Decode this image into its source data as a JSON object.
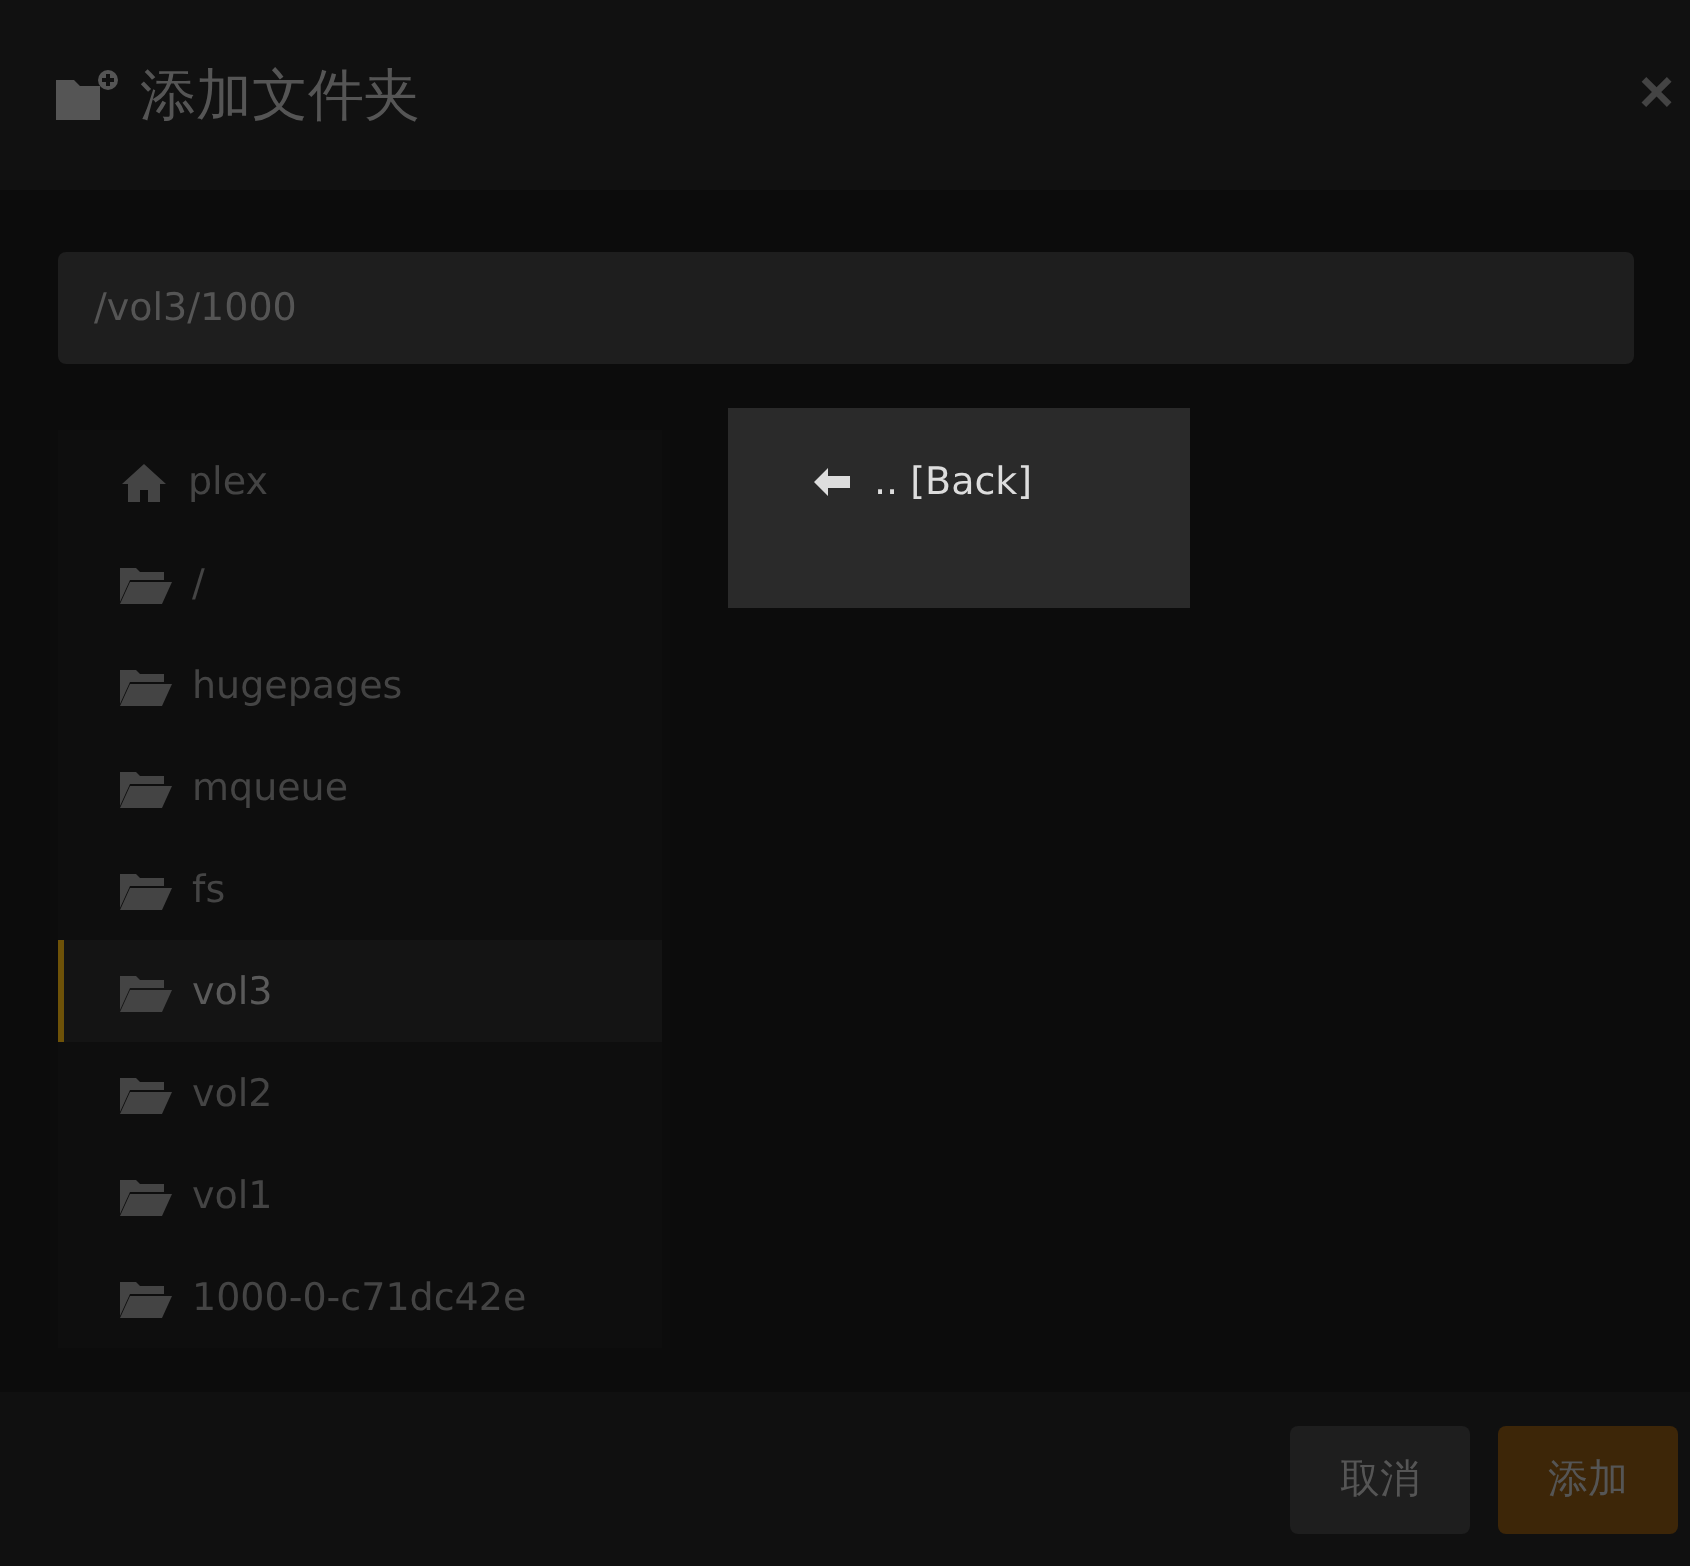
{
  "dialog": {
    "title": "添加文件夹",
    "close": "×"
  },
  "path_field": {
    "value": "/vol3/1000"
  },
  "folders": [
    {
      "name": "plex",
      "kind": "home",
      "selected": false
    },
    {
      "name": "/",
      "kind": "folder",
      "selected": false
    },
    {
      "name": "hugepages",
      "kind": "folder",
      "selected": false
    },
    {
      "name": "mqueue",
      "kind": "folder",
      "selected": false
    },
    {
      "name": "fs",
      "kind": "folder",
      "selected": false
    },
    {
      "name": "vol3",
      "kind": "folder",
      "selected": true
    },
    {
      "name": "vol2",
      "kind": "folder",
      "selected": false
    },
    {
      "name": "vol1",
      "kind": "folder",
      "selected": false
    },
    {
      "name": "1000-0-c71dc42e",
      "kind": "folder",
      "selected": false
    }
  ],
  "subfolders": [
    {
      "name": ".. [Back]",
      "kind": "back"
    }
  ],
  "buttons": [
    {
      "label": "取消",
      "kind": "secondary"
    },
    {
      "label": "添加",
      "kind": "primary"
    }
  ]
}
